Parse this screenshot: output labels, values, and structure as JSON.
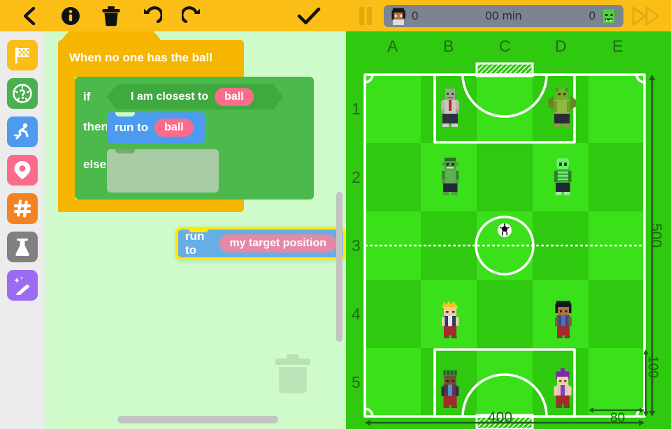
{
  "toolbar_left": {
    "items": [
      {
        "name": "back-button",
        "icon": "chevron-left-icon",
        "label": "Back"
      },
      {
        "name": "info-button",
        "icon": "info-icon",
        "label": "Info"
      },
      {
        "name": "delete-button",
        "icon": "trash-icon",
        "label": "Delete"
      },
      {
        "name": "undo-button",
        "icon": "undo-icon",
        "label": "Undo"
      },
      {
        "name": "redo-button",
        "icon": "redo-icon",
        "label": "Redo"
      },
      {
        "name": "confirm-button",
        "icon": "check-icon",
        "label": "Done"
      }
    ]
  },
  "toolbar_right": {
    "pause_label": "Pause",
    "fast_forward_label": "Fast forward",
    "scoreboard": {
      "home_score": "0",
      "away_score": "0",
      "time": "00 min",
      "home_avatar": "human-player-avatar",
      "away_avatar": "orc-player-avatar"
    }
  },
  "palette": {
    "categories": [
      {
        "name": "events",
        "icon": "flag-icon",
        "color": "#FBBE16"
      },
      {
        "name": "sensing",
        "icon": "soccer-ball-question-icon",
        "color": "#4CAF50"
      },
      {
        "name": "motion",
        "icon": "running-person-icon",
        "color": "#4C9BEE"
      },
      {
        "name": "position",
        "icon": "map-pin-icon",
        "color": "#FB6C8C"
      },
      {
        "name": "numbers",
        "icon": "hash-icon",
        "color": "#F58220"
      },
      {
        "name": "variables",
        "icon": "flask-icon",
        "color": "#808080"
      },
      {
        "name": "magic",
        "icon": "magic-wand-icon",
        "color": "#9B6CF2"
      }
    ]
  },
  "script": {
    "hat_label": "When no one has the ball",
    "if_keyword": "if",
    "then_keyword": "then",
    "else_keyword": "else",
    "condition_text": "I am closest to",
    "condition_value": "ball",
    "then_action_text": "run to",
    "then_action_value": "ball",
    "dragged_action_text": "run to",
    "dragged_action_value": "my target position"
  },
  "canvas": {
    "trash_drop_label": "Drop to delete",
    "vscrollbar_label": "Vertical scrollbar",
    "hscrollbar_label": "Horizontal scrollbar"
  },
  "field": {
    "column_labels": [
      "A",
      "B",
      "C",
      "D",
      "E"
    ],
    "row_labels": [
      "1",
      "2",
      "3",
      "4",
      "5"
    ],
    "dimensions": {
      "width": "400",
      "height": "500",
      "goal_box_width": "80",
      "goal_box_height": "100"
    },
    "ball": {
      "name": "soccer-ball",
      "cell": "C3"
    },
    "characters": [
      {
        "name": "zombie-goalkeeper",
        "cell": "B1",
        "team": "away",
        "skin": "#9aa68f",
        "hair": "#7d8a73",
        "shirt": "#c9c9c0",
        "pants": "#2e3142",
        "accent": "#c1232b"
      },
      {
        "name": "gargoyle-defender",
        "cell": "D1",
        "team": "away",
        "skin": "#7aa832",
        "hair": "#5e8c22",
        "shirt": "#8cba3c",
        "pants": "#2a2c3c",
        "accent": "#6e9c2a"
      },
      {
        "name": "orc-midfielder",
        "cell": "B2",
        "team": "away",
        "skin": "#4f9e46",
        "hair": "#2f6b2c",
        "shirt": "#5cb050",
        "pants": "#24283a",
        "accent": "#3c8036"
      },
      {
        "name": "skeleton-forward",
        "cell": "D2",
        "team": "away",
        "skin": "#6cf06c",
        "hair": "#4fd84f",
        "shirt": "#3da83d",
        "pants": "#232736",
        "accent": "#2d7d2d"
      },
      {
        "name": "blonde-striker",
        "cell": "B4",
        "team": "home",
        "skin": "#f3c9a0",
        "hair": "#f4c41e",
        "shirt": "#2b3a6b",
        "pants": "#a52a2a",
        "accent": "#e8b9a0"
      },
      {
        "name": "dark-hair-player",
        "cell": "D4",
        "team": "home",
        "skin": "#a9724a",
        "hair": "#18161c",
        "shirt": "#3a4a87",
        "pants": "#a52a2a",
        "accent": "#8a5a3a"
      },
      {
        "name": "green-hair-player",
        "cell": "B5",
        "team": "home",
        "skin": "#7a4a2e",
        "hair": "#2f8c33",
        "shirt": "#4a3a52",
        "pants": "#a52a2a",
        "accent": "#5b8fc9"
      },
      {
        "name": "purple-hair-keeper",
        "cell": "D5",
        "team": "home",
        "skin": "#f0cfa8",
        "hair": "#7d28a8",
        "shirt": "#ddc7c9",
        "pants": "#a52a2a",
        "accent": "#8b3fb0"
      }
    ]
  },
  "colors": {
    "toolbar": "#FBBE16",
    "canvas_bg": "#CFFBCB",
    "palette_bg": "#ECECEC",
    "pitch_light": "#3ae01a",
    "pitch_dark": "#2fc90f",
    "hat_block": "#F5B500",
    "control_block": "#4BB94B",
    "action_block": "#4C9BEE",
    "value_pill": "#FB6C8C",
    "highlight": "#FFE900"
  }
}
